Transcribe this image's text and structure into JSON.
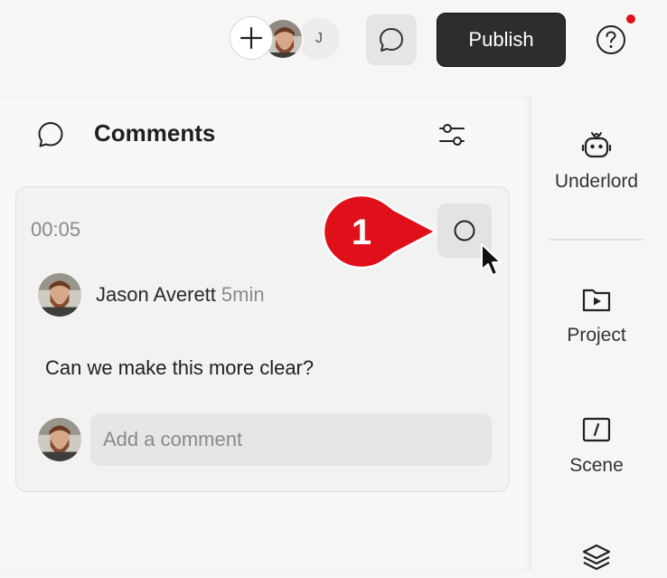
{
  "header": {
    "collaborator_initial": "J",
    "publish_label": "Publish"
  },
  "comments_panel": {
    "title": "Comments",
    "comment": {
      "timestamp": "00:05",
      "author": "Jason Averett",
      "age": "5min",
      "text": "Can we make this more clear?"
    },
    "reply_placeholder": "Add a comment"
  },
  "sidebar": {
    "items": [
      {
        "label": "Underlord",
        "icon": "robot-icon"
      },
      {
        "label": "Project",
        "icon": "folder-play-icon"
      },
      {
        "label": "Scene",
        "icon": "scene-slash-icon"
      },
      {
        "label": "",
        "icon": "layers-icon"
      }
    ]
  },
  "annotation": {
    "step_number": "1",
    "color": "#e0101a"
  },
  "colors": {
    "publish_bg": "#2d2d2d",
    "notification": "#e0101a",
    "card_bg": "#f2f2f2"
  }
}
